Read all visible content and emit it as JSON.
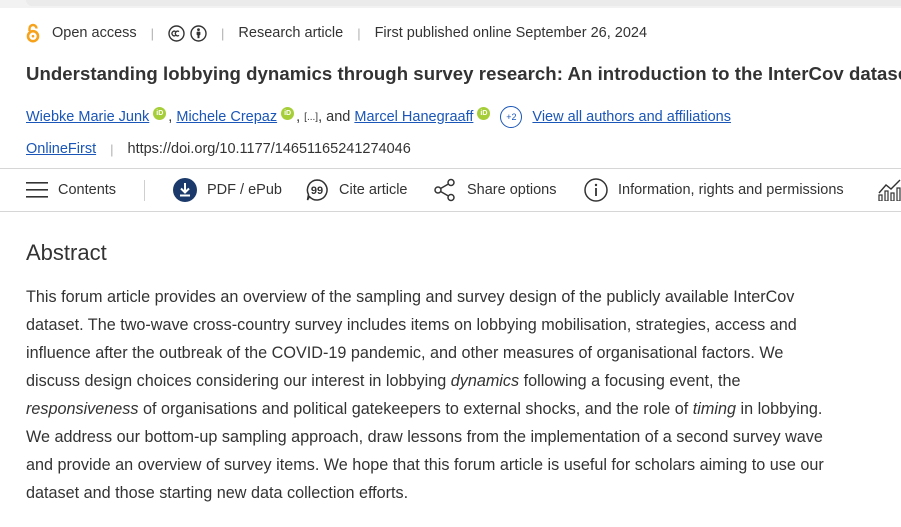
{
  "meta": {
    "open_access": "Open access",
    "article_type": "Research article",
    "published": "First published online September 26, 2024"
  },
  "title": "Understanding lobbying dynamics through survey research: An introduction to the InterCov dataset",
  "authors": {
    "author1": "Wiebke Marie Junk",
    "author2": "Michele Crepaz",
    "ellipsis": "[...]",
    "and": "and",
    "author3": "Marcel Hanegraaff",
    "more_count": "+2",
    "view_all": "View all authors and affiliations"
  },
  "doi_row": {
    "status": "OnlineFirst",
    "doi": "https://doi.org/10.1177/14651165241274046"
  },
  "toolbar": {
    "contents": "Contents",
    "pdf": "PDF / ePub",
    "cite": "Cite article",
    "share": "Share options",
    "info": "Information, rights and permissions"
  },
  "abstract": {
    "heading": "Abstract",
    "p1": "This forum article provides an overview of the sampling and survey design of the publicly available InterCov dataset. The two-wave cross-country survey includes items on lobbying mobilisation, strategies, access and influence after the outbreak of the COVID-19 pandemic, and other measures of organisational factors. We discuss design choices considering our interest in lobbying ",
    "em1": "dynamics",
    "p2": " following a focusing event, the ",
    "em2": "responsiveness",
    "p3": " of organisations and political gatekeepers to external shocks, and the role of ",
    "em3": "timing",
    "p4": " in lobbying. We address our bottom-up sampling approach, draw lessons from the implementation of a second survey wave and provide an overview of survey items. We hope that this forum article is useful for scholars aiming to use our dataset and those starting new data collection efforts."
  },
  "colors": {
    "link": "#1a56b8",
    "open_access": "#f7a21b",
    "orcid": "#a6ce39",
    "pdf_icon": "#1b3a6b"
  }
}
